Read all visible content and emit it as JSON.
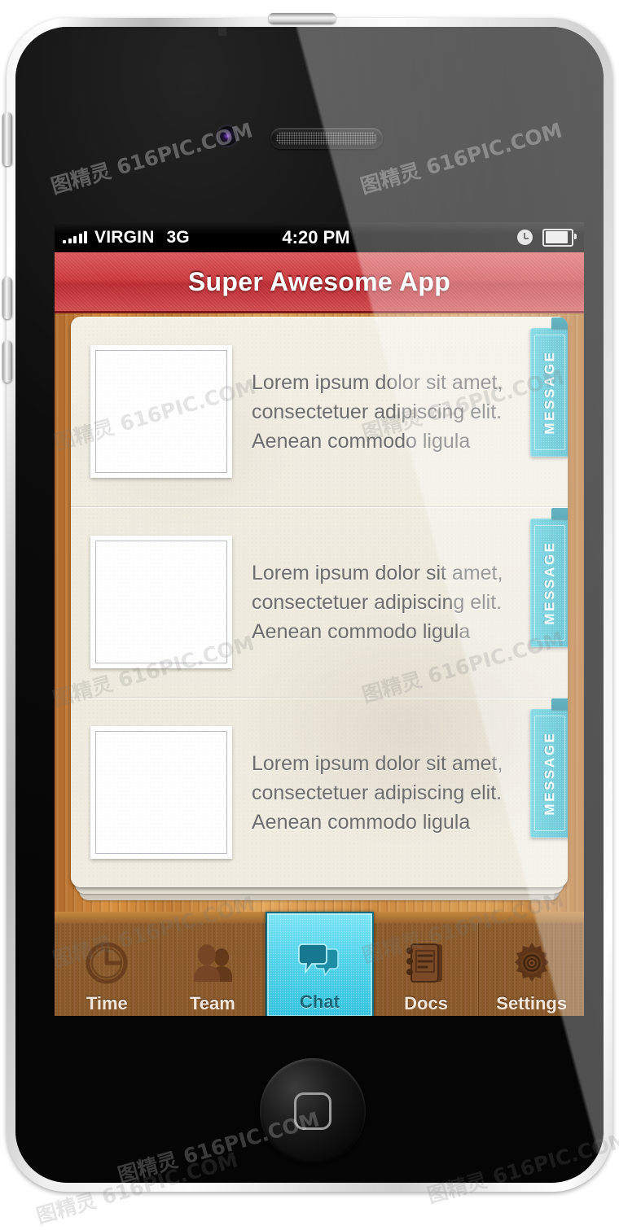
{
  "device": {
    "name": "smartphone-mockup",
    "hardware": {
      "camera": "front-camera",
      "speaker": "earpiece-speaker",
      "home_button": "home-button",
      "buttons": [
        "mute-switch",
        "volume-up",
        "volume-down",
        "power-button"
      ]
    }
  },
  "status_bar": {
    "carrier": "VIRGIN",
    "network": "3G",
    "time": "4:20 PM",
    "signal_bars": 5,
    "alarm_icon": "alarm-clock-icon",
    "battery_icon": "battery-icon",
    "battery_level": 82
  },
  "header": {
    "title": "Super Awesome App",
    "background_color": "#c9383c"
  },
  "list": {
    "items": [
      {
        "thumbnail": "photo-placeholder",
        "text": "Lorem ipsum dolor sit amet, consectetuer adipiscing elit. Aenean commodo ligula",
        "ribbon_label": "MESSAGE"
      },
      {
        "thumbnail": "photo-placeholder",
        "text": "Lorem ipsum dolor sit amet, consectetuer adipiscing elit. Aenean commodo ligula",
        "ribbon_label": "MESSAGE"
      },
      {
        "thumbnail": "photo-placeholder",
        "text": "Lorem ipsum dolor sit amet, consectetuer adipiscing elit. Aenean commodo ligula",
        "ribbon_label": "MESSAGE"
      }
    ]
  },
  "tabbar": {
    "active_index": 2,
    "accent_color": "#3fc9e4",
    "tabs": [
      {
        "label": "Time",
        "icon": "clock-icon"
      },
      {
        "label": "Team",
        "icon": "people-icon"
      },
      {
        "label": "Chat",
        "icon": "chat-bubbles-icon"
      },
      {
        "label": "Docs",
        "icon": "notebook-icon"
      },
      {
        "label": "Settings",
        "icon": "gear-icon"
      }
    ]
  },
  "watermark": {
    "text": "图精灵 616PIC.COM"
  }
}
